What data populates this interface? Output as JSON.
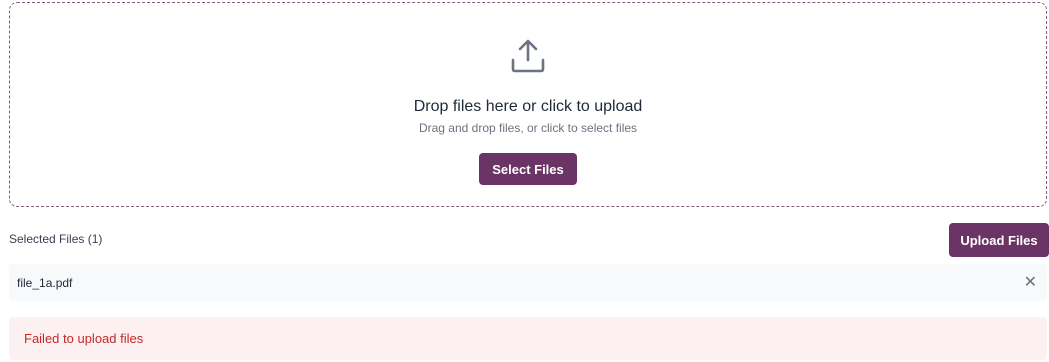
{
  "dropzone": {
    "icon": "upload-icon",
    "title": "Drop files here or click to upload",
    "subtitle": "Drag and drop files, or click to select files",
    "select_button_label": "Select Files"
  },
  "files": {
    "selected_label": "Selected Files (1)",
    "upload_button_label": "Upload Files",
    "items": [
      {
        "name": "file_1a.pdf",
        "remove_icon": "close-icon",
        "remove_glyph": "✕"
      }
    ]
  },
  "error": {
    "message": "Failed to upload files"
  },
  "colors": {
    "accent": "#6b3466",
    "error_text": "#c62828",
    "error_bg": "#fdf0f0",
    "dashed_border": "#8a5a7e"
  }
}
